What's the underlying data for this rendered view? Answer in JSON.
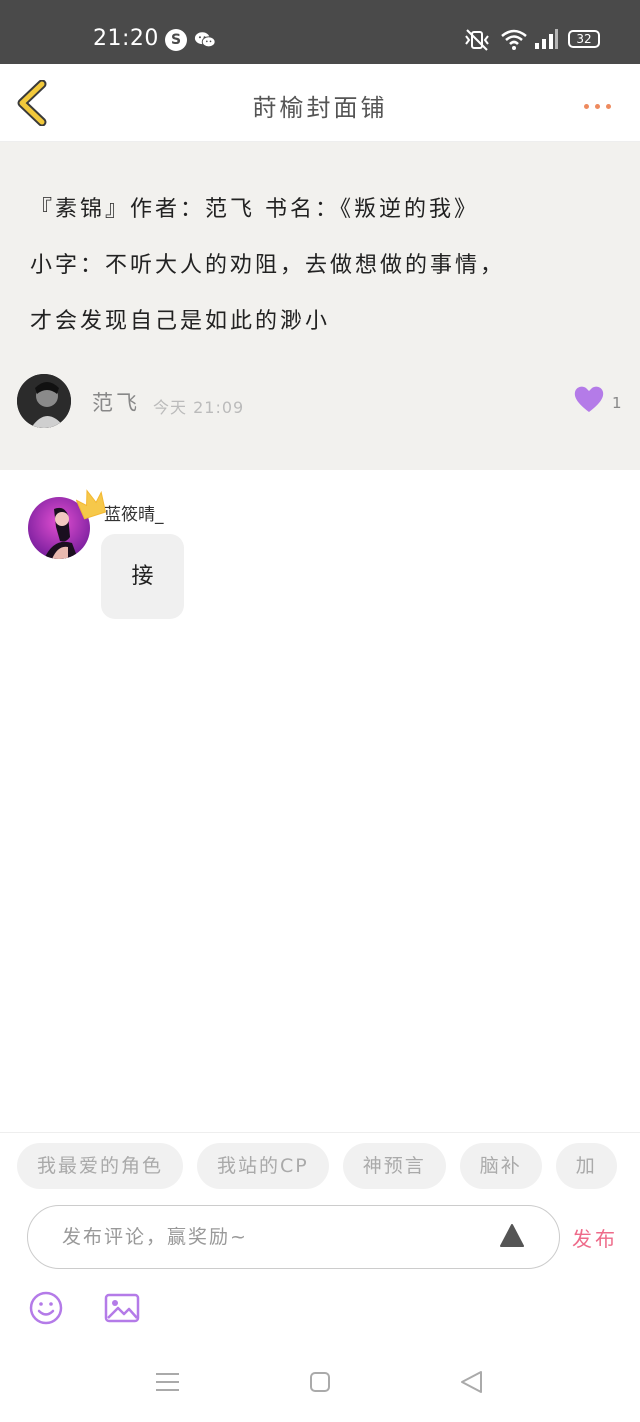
{
  "status_bar": {
    "time": "21:20",
    "battery": "32"
  },
  "header": {
    "title": "莳榆封面铺"
  },
  "post": {
    "lines": [
      "『素锦』作者：范飞    书名：《叛逆的我》",
      "小字：不听大人的劝阻，去做想做的事情，",
      "才会发现自己是如此的渺小"
    ],
    "author": "范飞",
    "time": "今天 21:09",
    "likes": "1"
  },
  "comment": {
    "user": "蓝筱晴_",
    "text": "接"
  },
  "chips": [
    "我最爱的角色",
    "我站的CP",
    "神预言",
    "脑补",
    "加"
  ],
  "input": {
    "placeholder": "发布评论，赢奖励~",
    "publish_label": "发布"
  },
  "colors": {
    "accent_pink": "#ee6b8a",
    "like_purple": "#b47be8",
    "back_yellow": "#f2c93b",
    "post_background": "#f2f1ee"
  },
  "icons": [
    "back-chevron-icon",
    "more-dots-icon",
    "heart-icon",
    "crown-icon",
    "send-arrow-icon",
    "emoji-icon",
    "image-icon",
    "nav-menu-icon",
    "nav-home-icon",
    "nav-back-icon"
  ]
}
